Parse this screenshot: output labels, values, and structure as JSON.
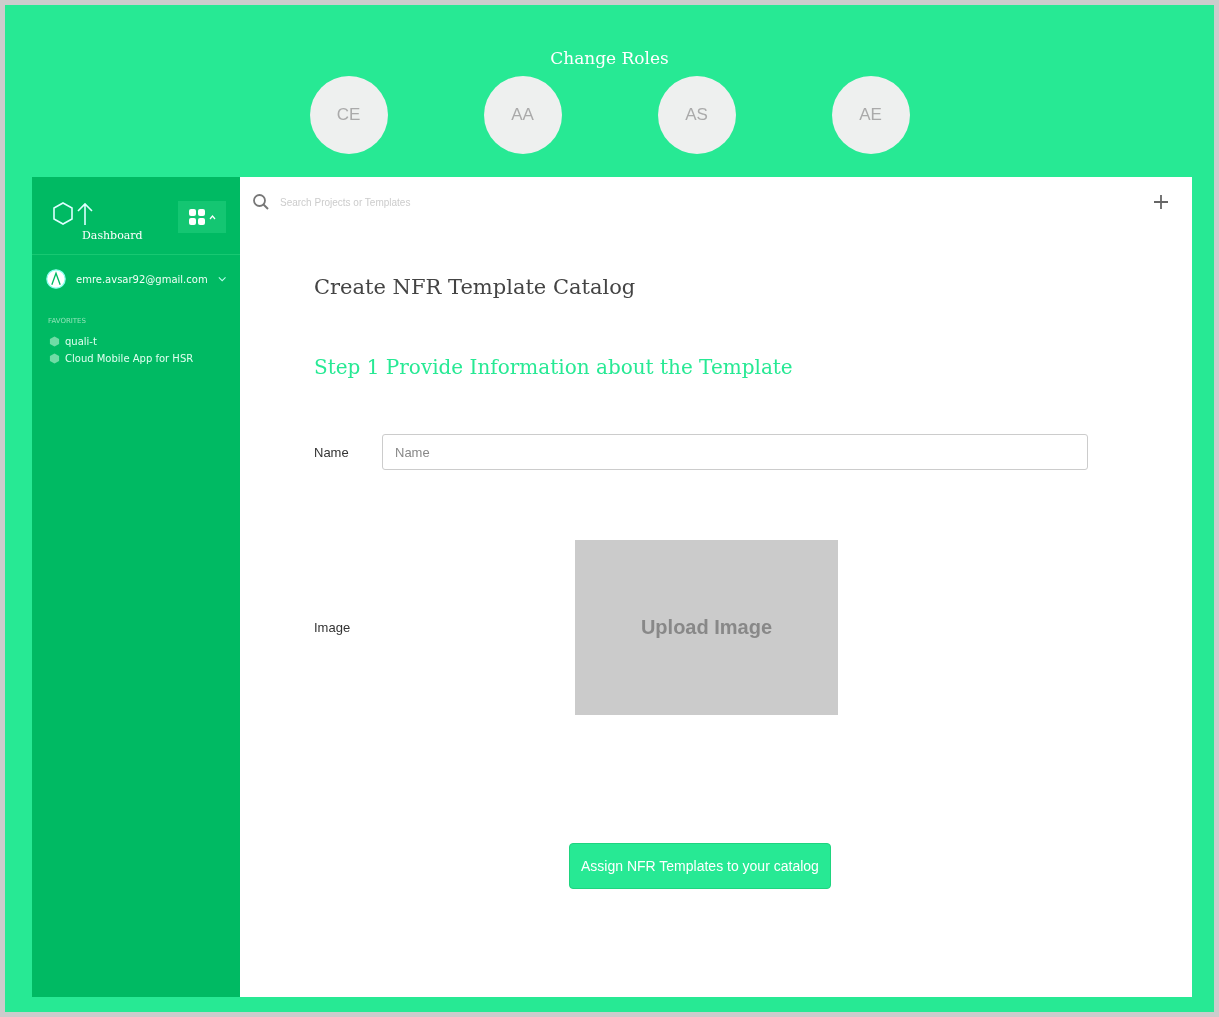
{
  "header": {
    "title": "Change Roles",
    "roles": [
      {
        "label": "CE"
      },
      {
        "label": "AA"
      },
      {
        "label": "AS"
      },
      {
        "label": "AE"
      }
    ]
  },
  "sidebar": {
    "app_name": "Dashboard",
    "user_email": "emre.avsar92@gmail.com",
    "section_title": "FAVORITES",
    "favorites": [
      {
        "label": "quali-t"
      },
      {
        "label": "Cloud Mobile App for HSR"
      }
    ]
  },
  "search": {
    "placeholder": "Search Projects or Templates"
  },
  "page_title": "Create NFR Template Catalog",
  "step_title": "Step 1 Provide Information about the Template",
  "form": {
    "name_label": "Name",
    "name_placeholder": "Name",
    "image_label": "Image",
    "upload_text": "Upload Image"
  },
  "submit_button": "Assign NFR Templates to your catalog"
}
